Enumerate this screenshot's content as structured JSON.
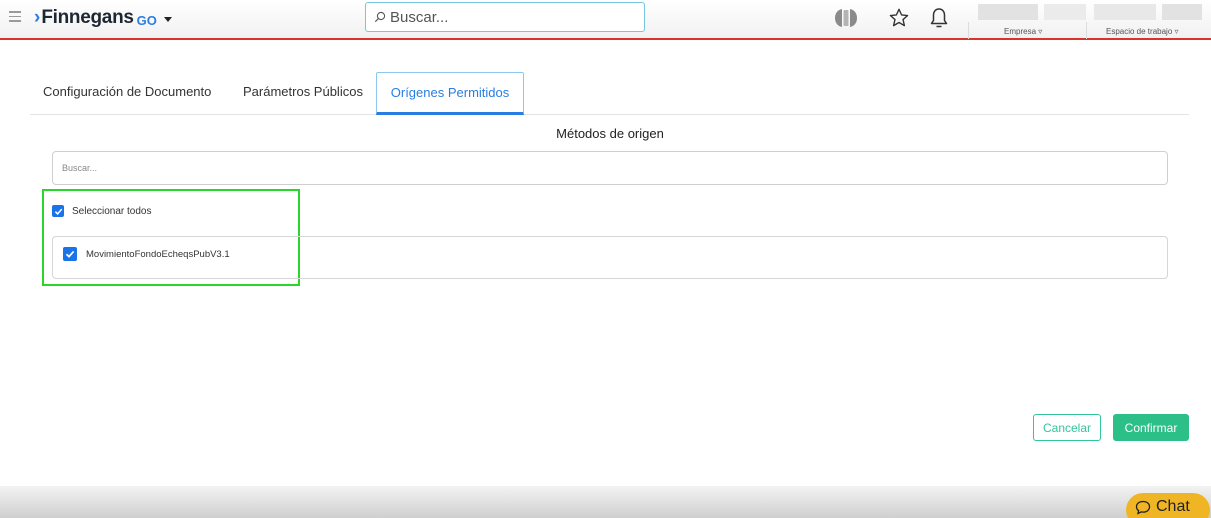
{
  "topbar": {
    "brand_name": "Finnegans",
    "brand_suffix": "GO",
    "search_placeholder": "Buscar...",
    "empresa_label": "Empresa ▿",
    "espacio_label": "Espacio de trabajo ▿"
  },
  "tabs": [
    {
      "label": "Configuración de Documento",
      "active": false
    },
    {
      "label": "Parámetros Públicos",
      "active": false
    },
    {
      "label": "Orígenes Permitidos",
      "active": true
    }
  ],
  "section": {
    "title": "Métodos de origen",
    "filter_placeholder": "Buscar..."
  },
  "select_all": {
    "label": "Seleccionar todos",
    "checked": true
  },
  "items": [
    {
      "label": "MovimientoFondoEcheqsPubV3.1",
      "checked": true
    }
  ],
  "actions": {
    "cancel": "Cancelar",
    "confirm": "Confirmar"
  },
  "chat": {
    "label": "Chat"
  },
  "colors": {
    "accent_blue": "#2a7de1",
    "header_border": "#d9342b",
    "confirm_green": "#2dbf88",
    "highlight_green": "#2bd62b",
    "chat_yellow": "#f0b524"
  }
}
